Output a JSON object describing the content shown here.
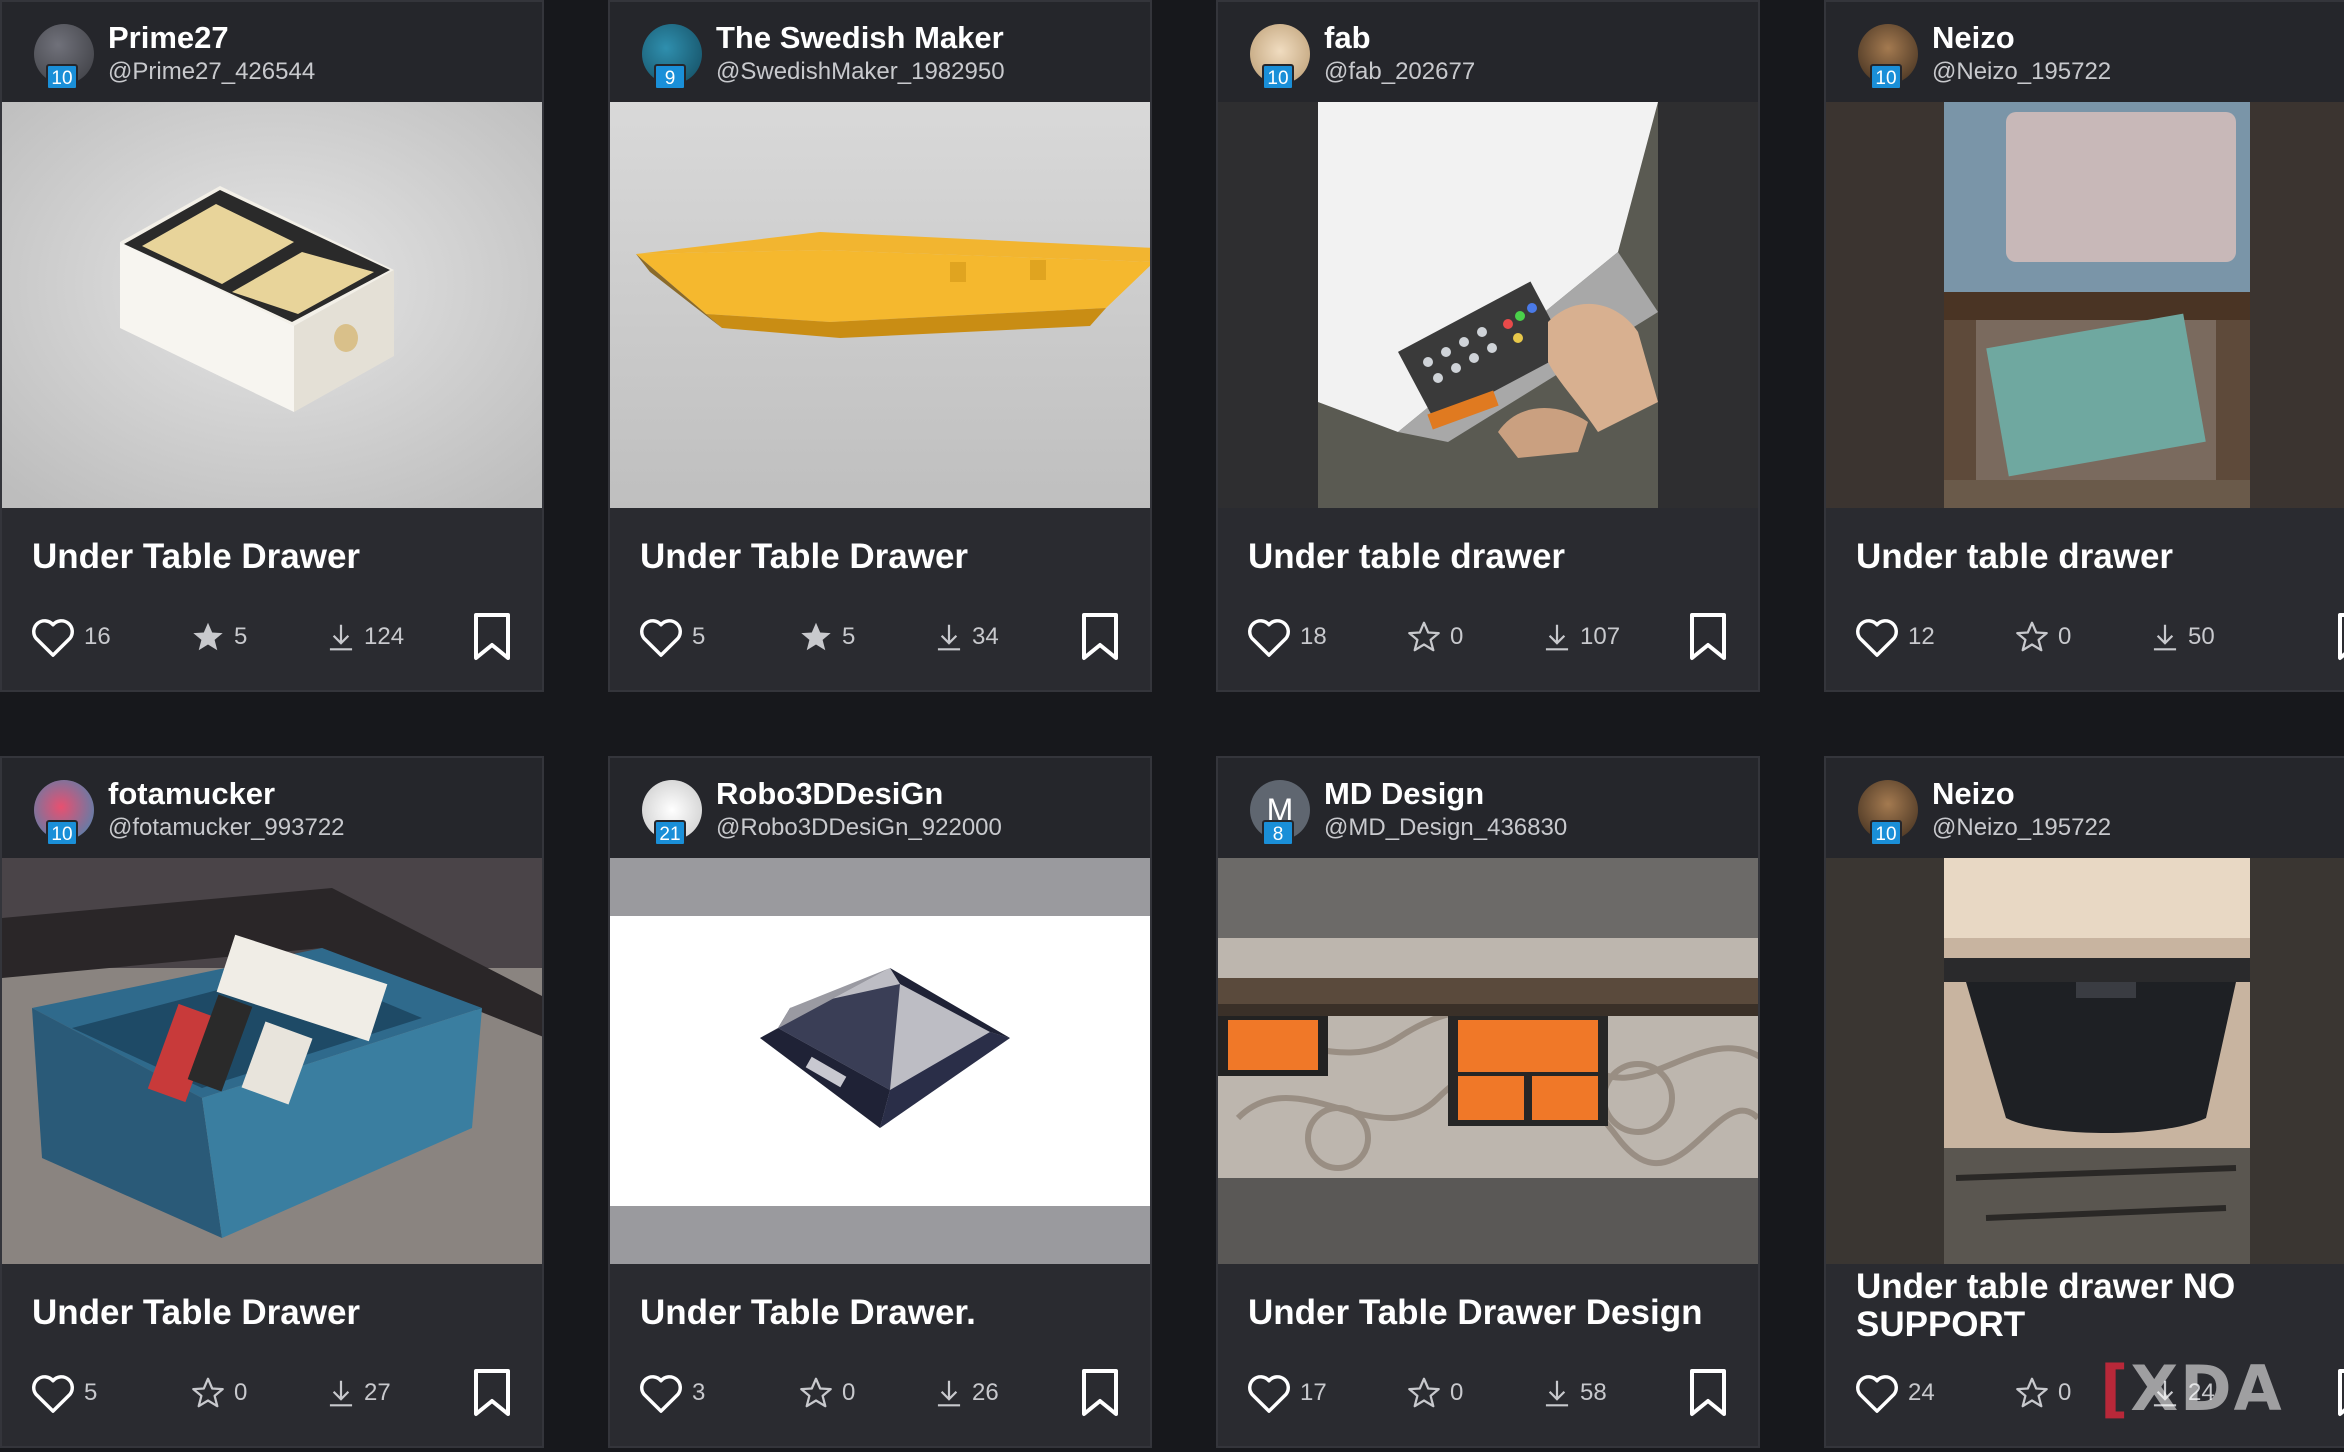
{
  "cards": [
    {
      "author_name": "Prime27",
      "author_handle": "@Prime27_426544",
      "level": "10",
      "avatar_letter": "",
      "avatar_color": "#55565c",
      "title": "Under Table Drawer",
      "likes": "16",
      "stars": "5",
      "stars_filled": true,
      "downloads": "124"
    },
    {
      "author_name": "The Swedish Maker",
      "author_handle": "@SwedishMaker_1982950",
      "level": "9",
      "avatar_letter": "",
      "avatar_color": "#1e6f8c",
      "title": "Under Table Drawer",
      "likes": "5",
      "stars": "5",
      "stars_filled": true,
      "downloads": "34"
    },
    {
      "author_name": "fab",
      "author_handle": "@fab_202677",
      "level": "10",
      "avatar_letter": "",
      "avatar_color": "#e8d2b0",
      "title": "Under table drawer",
      "likes": "18",
      "stars": "0",
      "stars_filled": false,
      "downloads": "107"
    },
    {
      "author_name": "Neizo",
      "author_handle": "@Neizo_195722",
      "level": "10",
      "avatar_letter": "",
      "avatar_color": "#6b4a2f",
      "title": "Under table drawer",
      "likes": "12",
      "stars": "0",
      "stars_filled": false,
      "downloads": "50"
    },
    {
      "author_name": "fotamucker",
      "author_handle": "@fotamucker_993722",
      "level": "10",
      "avatar_letter": "",
      "avatar_color": "#c8405a",
      "title": "Under Table Drawer",
      "likes": "5",
      "stars": "0",
      "stars_filled": false,
      "downloads": "27"
    },
    {
      "author_name": "Robo3DDesiGn",
      "author_handle": "@Robo3DDesiGn_922000",
      "level": "21",
      "avatar_letter": "",
      "avatar_color": "#e9e9e9",
      "title": "Under Table Drawer.",
      "likes": "3",
      "stars": "0",
      "stars_filled": false,
      "downloads": "26"
    },
    {
      "author_name": "MD Design",
      "author_handle": "@MD_Design_436830",
      "level": "8",
      "avatar_letter": "M",
      "avatar_color": "#5f6670",
      "title": "Under Table Drawer Design",
      "likes": "17",
      "stars": "0",
      "stars_filled": false,
      "downloads": "58"
    },
    {
      "author_name": "Neizo",
      "author_handle": "@Neizo_195722",
      "level": "10",
      "avatar_letter": "",
      "avatar_color": "#6b4a2f",
      "title": "Under table drawer NO SUPPORT",
      "likes": "24",
      "stars": "0",
      "stars_filled": false,
      "downloads": "24"
    }
  ],
  "watermark": "XDA"
}
